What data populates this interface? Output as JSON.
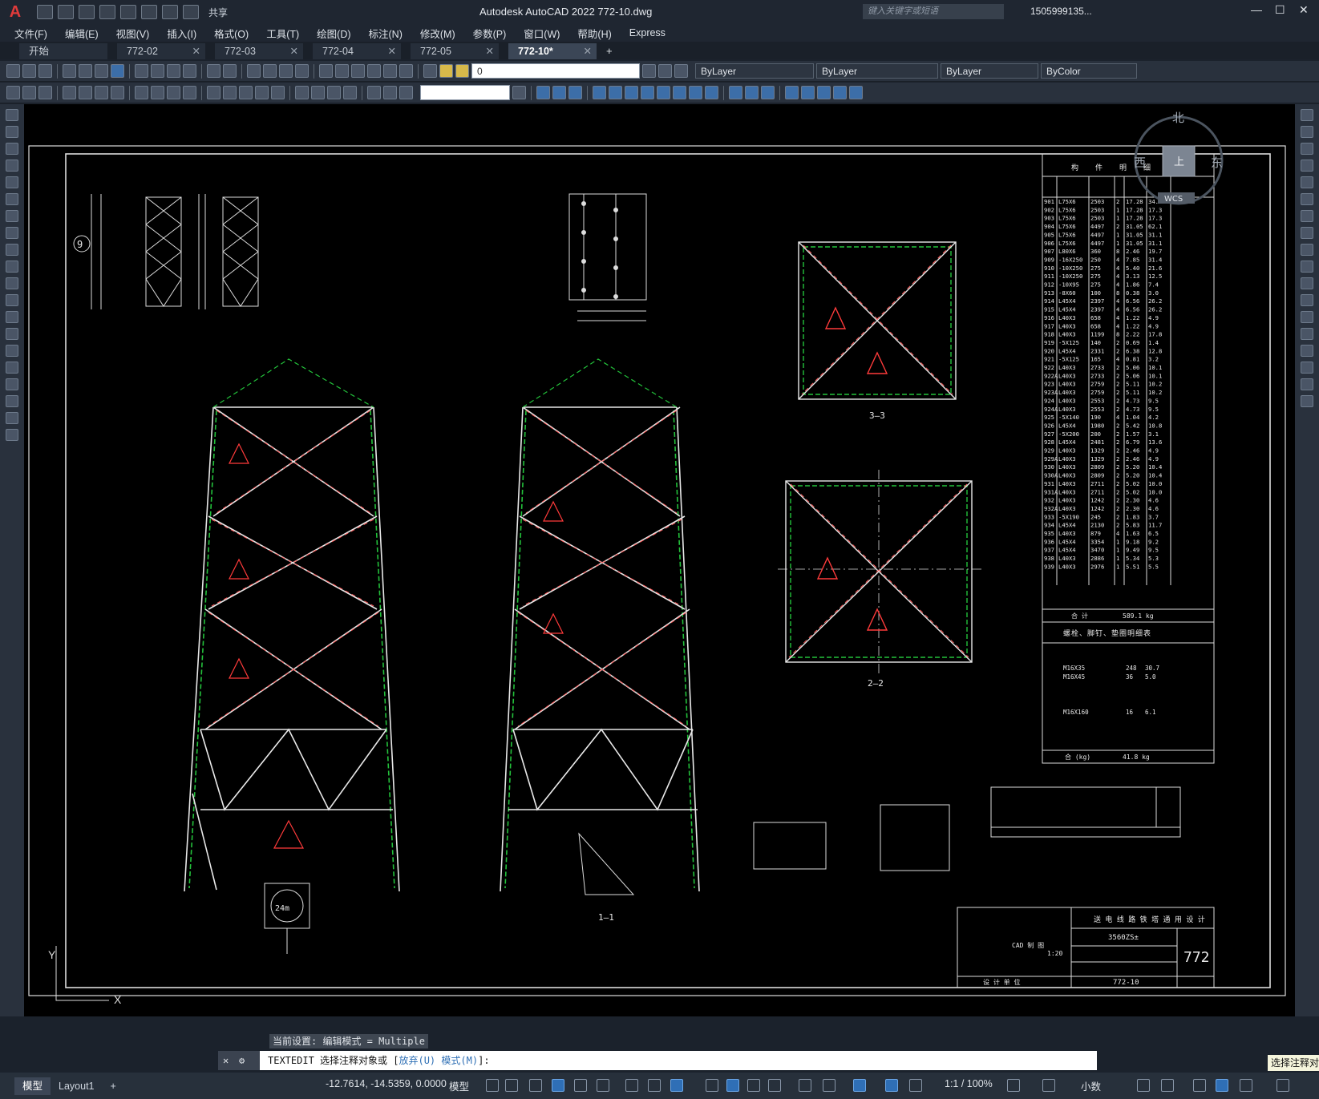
{
  "app": {
    "logo": "A",
    "title": "Autodesk AutoCAD 2022    772-10.dwg",
    "search_placeholder": "键入关键字或短语",
    "user": "1505999135...",
    "share": "共享",
    "icons": [
      "new-icon",
      "open-icon",
      "save-icon",
      "saveas-icon",
      "publish-icon",
      "plot-icon",
      "undo-icon",
      "redo-icon",
      "share-icon"
    ]
  },
  "menu": [
    "文件(F)",
    "编辑(E)",
    "视图(V)",
    "插入(I)",
    "格式(O)",
    "工具(T)",
    "绘图(D)",
    "标注(N)",
    "修改(M)",
    "参数(P)",
    "窗口(W)",
    "帮助(H)",
    "Express"
  ],
  "tabs": [
    {
      "label": "开始",
      "active": false,
      "closable": false
    },
    {
      "label": "772-02",
      "active": false,
      "closable": true
    },
    {
      "label": "772-03",
      "active": false,
      "closable": true
    },
    {
      "label": "772-04",
      "active": false,
      "closable": true
    },
    {
      "label": "772-05",
      "active": false,
      "closable": true
    },
    {
      "label": "772-10*",
      "active": true,
      "closable": true
    }
  ],
  "tab_add": "+",
  "layer": {
    "current": "0",
    "color_combo": "ByLayer",
    "linetype_combo": "ByLayer",
    "lineweight_combo": "ByLayer",
    "plotstyle_combo": "ByColor"
  },
  "viewcube": {
    "north": "北",
    "west": "西",
    "east": "东",
    "top": "上",
    "wcs": "WCS"
  },
  "drawing": {
    "bom_header": [
      "构",
      "件",
      "明",
      "细",
      "表"
    ],
    "bom_rows": [
      [
        "901",
        "L75X6",
        "2503",
        "2",
        "17.28",
        "34.6"
      ],
      [
        "902",
        "L75X6",
        "2503",
        "1",
        "17.28",
        "17.3"
      ],
      [
        "903",
        "L75X6",
        "2503",
        "1",
        "17.28",
        "17.3"
      ],
      [
        "904",
        "L75X6",
        "4497",
        "2",
        "31.05",
        "62.1"
      ],
      [
        "905",
        "L75X6",
        "4497",
        "1",
        "31.05",
        "31.1"
      ],
      [
        "906",
        "L75X6",
        "4497",
        "1",
        "31.05",
        "31.1"
      ],
      [
        "907",
        "L80X6",
        "360",
        "8",
        "2.46",
        "19.7"
      ],
      [
        "909",
        "-16X250",
        "250",
        "4",
        "7.85",
        "31.4"
      ],
      [
        "910",
        "-10X250",
        "275",
        "4",
        "5.40",
        "21.6"
      ],
      [
        "911",
        "-10X250",
        "275",
        "4",
        "3.13",
        "12.5"
      ],
      [
        "912",
        "-10X95",
        "275",
        "4",
        "1.86",
        "7.4"
      ],
      [
        "913",
        "-8X60",
        "100",
        "8",
        "0.38",
        "3.0"
      ],
      [
        "914",
        "L45X4",
        "2397",
        "4",
        "6.56",
        "26.2"
      ],
      [
        "915",
        "L45X4",
        "2397",
        "4",
        "6.56",
        "26.2"
      ],
      [
        "916",
        "L40X3",
        "658",
        "4",
        "1.22",
        "4.9"
      ],
      [
        "917",
        "L40X3",
        "658",
        "4",
        "1.22",
        "4.9"
      ],
      [
        "918",
        "L40X3",
        "1199",
        "8",
        "2.22",
        "17.8"
      ],
      [
        "919",
        "-5X125",
        "140",
        "2",
        "0.69",
        "1.4"
      ],
      [
        "920",
        "L45X4",
        "2331",
        "2",
        "6.38",
        "12.8"
      ],
      [
        "921",
        "-5X125",
        "165",
        "4",
        "0.81",
        "3.2"
      ],
      [
        "922",
        "L40X3",
        "2733",
        "2",
        "5.06",
        "10.1"
      ],
      [
        "922A",
        "L40X3",
        "2733",
        "2",
        "5.06",
        "10.1"
      ],
      [
        "923",
        "L40X3",
        "2759",
        "2",
        "5.11",
        "10.2"
      ],
      [
        "923A",
        "L40X3",
        "2759",
        "2",
        "5.11",
        "10.2"
      ],
      [
        "924",
        "L40X3",
        "2553",
        "2",
        "4.73",
        "9.5"
      ],
      [
        "924A",
        "L40X3",
        "2553",
        "2",
        "4.73",
        "9.5"
      ],
      [
        "925",
        "-5X140",
        "190",
        "4",
        "1.04",
        "4.2"
      ],
      [
        "926",
        "L45X4",
        "1980",
        "2",
        "5.42",
        "10.8"
      ],
      [
        "927",
        "-5X200",
        "200",
        "2",
        "1.57",
        "3.1"
      ],
      [
        "928",
        "L45X4",
        "2481",
        "2",
        "6.79",
        "13.6"
      ],
      [
        "929",
        "L40X3",
        "1329",
        "2",
        "2.46",
        "4.9"
      ],
      [
        "929A",
        "L40X3",
        "1329",
        "2",
        "2.46",
        "4.9"
      ],
      [
        "930",
        "L40X3",
        "2809",
        "2",
        "5.20",
        "10.4"
      ],
      [
        "930A",
        "L40X3",
        "2809",
        "2",
        "5.20",
        "10.4"
      ],
      [
        "931",
        "L40X3",
        "2711",
        "2",
        "5.02",
        "10.0"
      ],
      [
        "931A",
        "L40X3",
        "2711",
        "2",
        "5.02",
        "10.0"
      ],
      [
        "932",
        "L40X3",
        "1242",
        "2",
        "2.30",
        "4.6"
      ],
      [
        "932A",
        "L40X3",
        "1242",
        "2",
        "2.30",
        "4.6"
      ],
      [
        "933",
        "-5X190",
        "245",
        "2",
        "1.83",
        "3.7"
      ],
      [
        "934",
        "L45X4",
        "2130",
        "2",
        "5.83",
        "11.7"
      ],
      [
        "935",
        "L40X3",
        "879",
        "4",
        "1.63",
        "6.5"
      ],
      [
        "936",
        "L45X4",
        "3354",
        "1",
        "9.18",
        "9.2"
      ],
      [
        "937",
        "L45X4",
        "3470",
        "1",
        "9.49",
        "9.5"
      ],
      [
        "938",
        "L40X3",
        "2886",
        "1",
        "5.34",
        "5.3"
      ],
      [
        "939",
        "L40X3",
        "2976",
        "1",
        "5.51",
        "5.5"
      ]
    ],
    "bom_total_label": "合 计",
    "bom_total": "589.1 kg",
    "bolt_header": [
      "螺",
      "栓",
      "、",
      "脚",
      "钉",
      "、",
      "垫",
      "圈",
      "明",
      "细",
      "表"
    ],
    "bolt_rows": [
      [
        "M16X35",
        "248",
        "30.7"
      ],
      [
        "M16X45",
        "36",
        "5.0"
      ],
      [
        "M16X160",
        "16",
        "6.1"
      ]
    ],
    "bolt_total_label": "合 (kg)",
    "bolt_total": "41.8 kg",
    "section_labels": [
      "3—3",
      "2—2",
      "1—1"
    ],
    "title_block": {
      "header": "送 电 线 路 铁 塔 通 用 设 计",
      "code": "3560ZS±",
      "sheet": "772-10",
      "big_no": "772",
      "scale": "1:20",
      "org": "设 计 单 位",
      "cad": "CAD 制 图"
    },
    "callout": "9",
    "base_label": "24m"
  },
  "axes": {
    "y": "Y",
    "x": "X"
  },
  "command": {
    "hint": "当前设置: 编辑模式 = Multiple",
    "prefix": "TEXTEDIT 选择注释对象或 [",
    "opt1": "放弃(U)",
    "sep": " ",
    "opt2": "模式(M)",
    "suffix": "]:",
    "tooltip": "选择注释对象"
  },
  "status": {
    "layouts": [
      "模型",
      "Layout1"
    ],
    "coords": "-12.7614, -14.5359, 0.0000",
    "model": "模型",
    "scale": "1:1 / 100%",
    "units": "小数"
  }
}
